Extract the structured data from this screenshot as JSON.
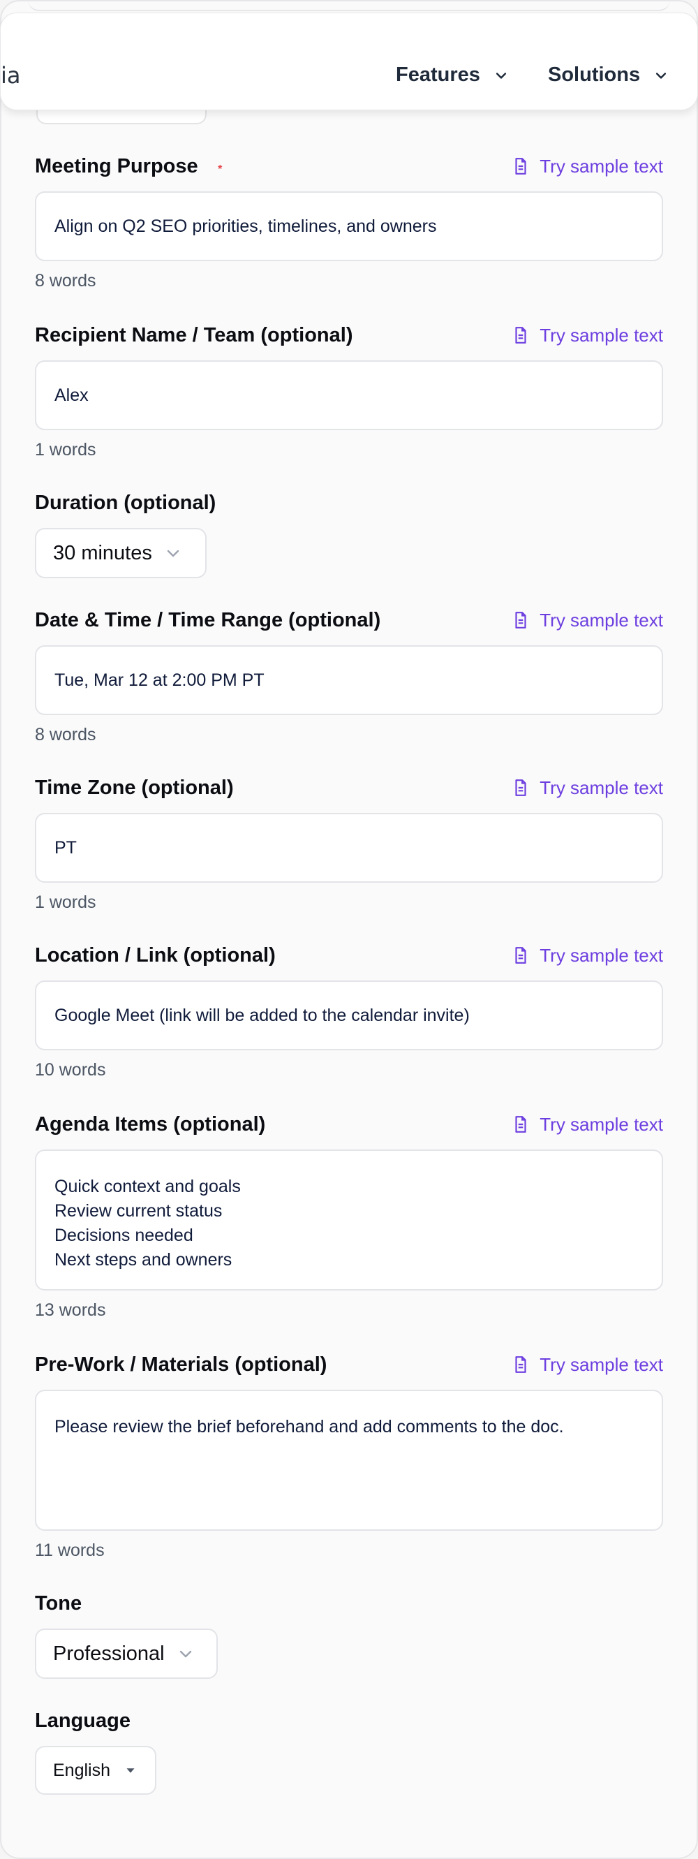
{
  "nav": {
    "brand_fragment": "ia",
    "items": [
      {
        "label": "Features"
      },
      {
        "label": "Solutions"
      }
    ]
  },
  "sample_label": "Try sample text",
  "fields": {
    "purpose": {
      "label": "Meeting Purpose",
      "required_mark": "*",
      "value": "Align on Q2 SEO priorities, timelines, and owners",
      "count": "8 words"
    },
    "recipient": {
      "label": "Recipient Name / Team (optional)",
      "value": "Alex",
      "count": "1 words"
    },
    "duration": {
      "label": "Duration (optional)",
      "value": "30 minutes"
    },
    "datetime": {
      "label": "Date & Time / Time Range (optional)",
      "value": "Tue, Mar 12 at 2:00 PM PT",
      "count": "8 words"
    },
    "timezone": {
      "label": "Time Zone (optional)",
      "value": "PT",
      "count": "1 words"
    },
    "location": {
      "label": "Location / Link (optional)",
      "value": "Google Meet (link will be added to the calendar invite)",
      "count": "10 words"
    },
    "agenda": {
      "label": "Agenda Items (optional)",
      "value": "Quick context and goals\nReview current status\nDecisions needed\nNext steps and owners",
      "count": "13 words"
    },
    "prework": {
      "label": "Pre-Work / Materials (optional)",
      "value": "Please review the brief beforehand and add comments to the doc.",
      "count": "11 words"
    },
    "tone": {
      "label": "Tone",
      "value": "Professional"
    },
    "language": {
      "label": "Language",
      "value": "English"
    }
  },
  "colors": {
    "accent": "#6d3fe0",
    "required": "#e5484d"
  },
  "icons": {
    "sample": "document-icon",
    "chevron": "chevron-down-icon",
    "caret": "caret-down-icon"
  }
}
